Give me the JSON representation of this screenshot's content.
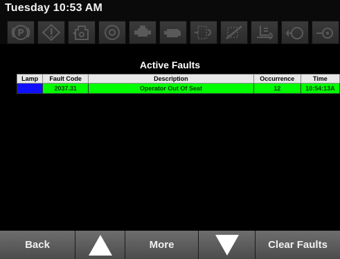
{
  "header": {
    "datetime": "Tuesday 10:53 AM",
    "indicators": [
      {
        "icon": "park-brake-icon"
      },
      {
        "icon": "warning-diamond-icon"
      },
      {
        "icon": "coolant-temp-icon"
      },
      {
        "icon": "air-filter-icon"
      },
      {
        "icon": "engine-icon"
      },
      {
        "icon": "engine-check-icon"
      },
      {
        "icon": "dpf-icon"
      },
      {
        "icon": "dpf-disabled-icon"
      },
      {
        "icon": "exhaust-temp-icon"
      },
      {
        "icon": "hydraulic-oil-icon"
      },
      {
        "icon": "oil-pressure-icon"
      }
    ]
  },
  "faults": {
    "title": "Active Faults",
    "columns": {
      "lamp": "Lamp",
      "code": "Fault Code",
      "description": "Description",
      "occurrence": "Occurrence",
      "time": "Time"
    },
    "rows": [
      {
        "lamp_color": "#1010ff",
        "code": "2037.31",
        "description": "Operator Out Of Seat",
        "occurrence": "12",
        "time": "10:54:13A"
      }
    ]
  },
  "footer": {
    "back": "Back",
    "up": "up-arrow-icon",
    "more": "More",
    "down": "down-arrow-icon",
    "clear": "Clear Faults"
  }
}
